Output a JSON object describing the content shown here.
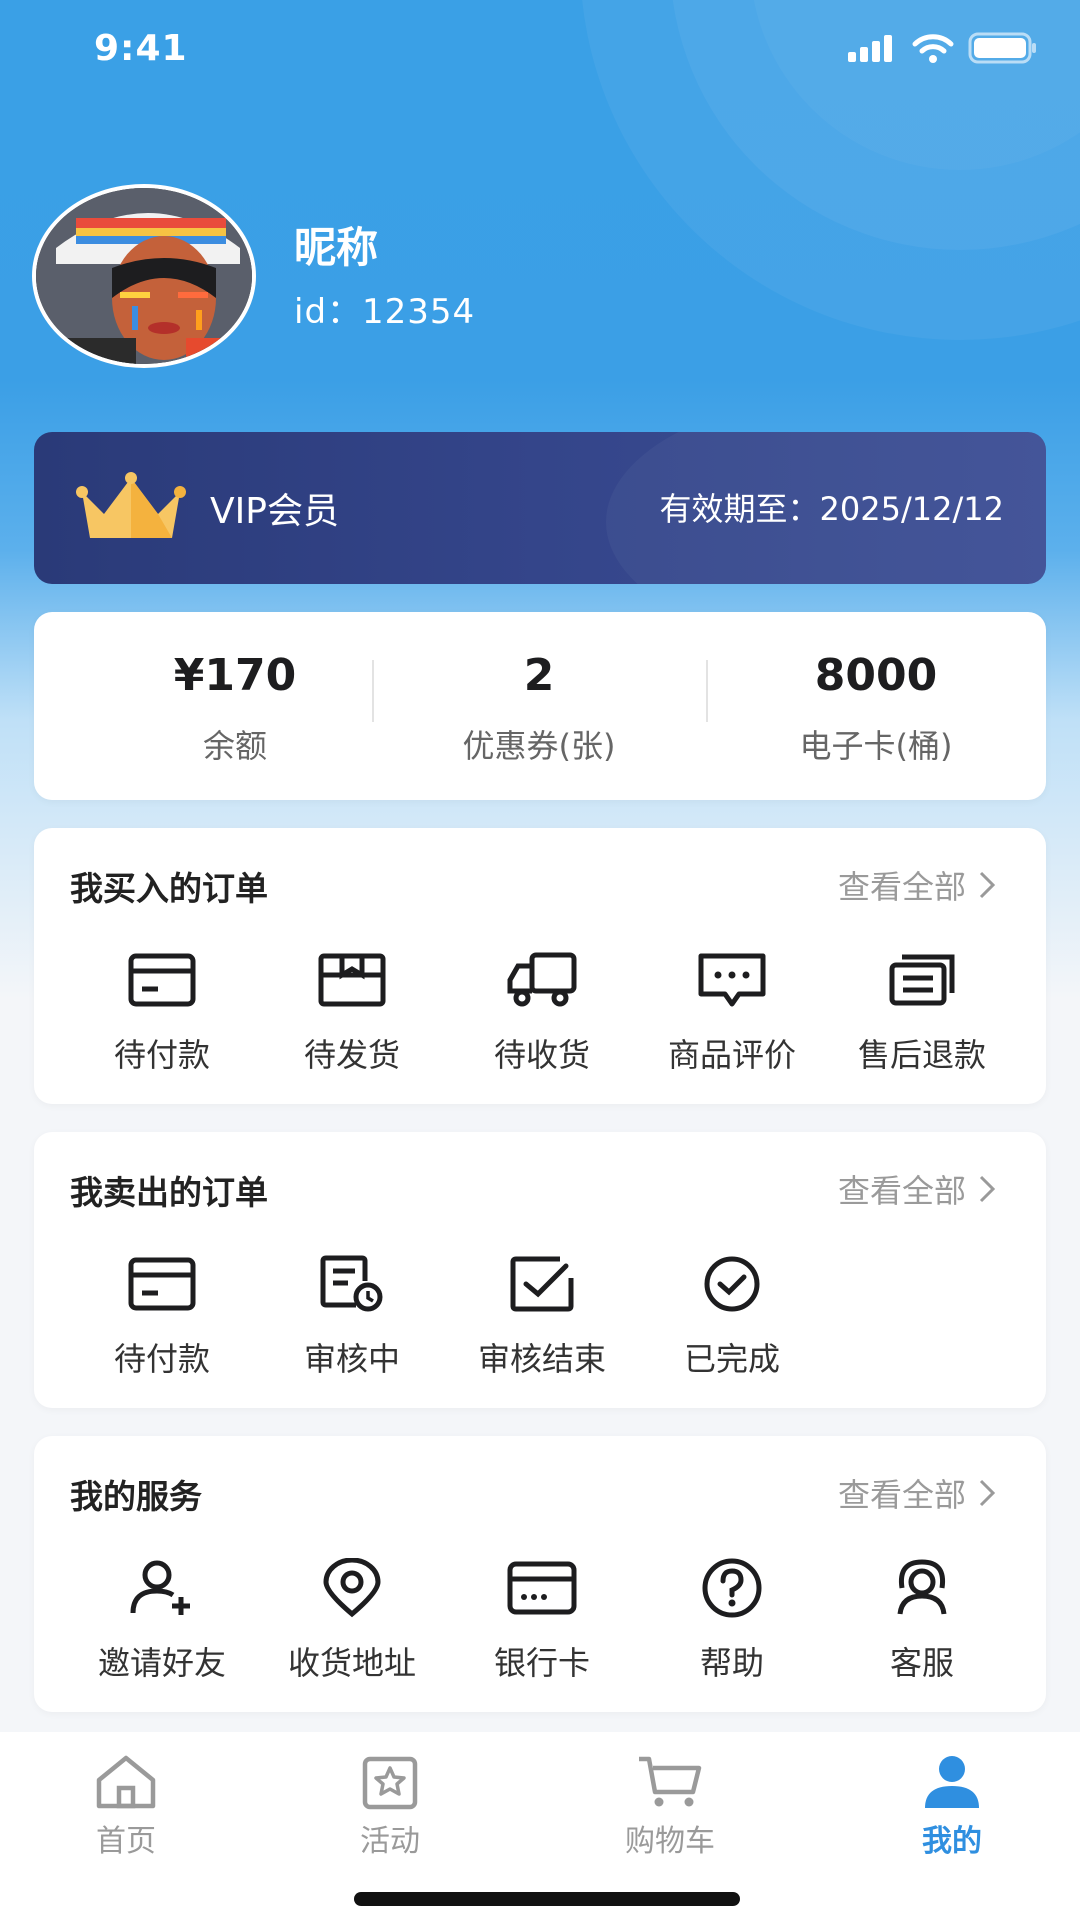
{
  "status_bar": {
    "time": "9:41",
    "icons": [
      "signal-icon",
      "wifi-icon",
      "battery-icon"
    ]
  },
  "profile": {
    "nickname": "昵称",
    "user_id": "id：12354",
    "avatar": "avatar-photo"
  },
  "vip": {
    "label": "VIP会员",
    "expiry": "有效期至：2025/12/12",
    "icon": "crown-icon"
  },
  "stats": [
    {
      "value": "¥170",
      "label": "余额"
    },
    {
      "value": "2",
      "label": "优惠券(张)"
    },
    {
      "value": "8000",
      "label": "电子卡(桶)"
    }
  ],
  "orders_buy": {
    "title": "我买入的订单",
    "view_all": "查看全部",
    "items": [
      {
        "label": "待付款",
        "icon": "card-icon"
      },
      {
        "label": "待发货",
        "icon": "box-icon"
      },
      {
        "label": "待收货",
        "icon": "truck-icon"
      },
      {
        "label": "商品评价",
        "icon": "comment-icon"
      },
      {
        "label": "售后退款",
        "icon": "refund-icon"
      }
    ]
  },
  "orders_sell": {
    "title": "我卖出的订单",
    "view_all": "查看全部",
    "items": [
      {
        "label": "待付款",
        "icon": "card-icon"
      },
      {
        "label": "审核中",
        "icon": "review-pending-icon"
      },
      {
        "label": "审核结束",
        "icon": "review-done-icon"
      },
      {
        "label": "已完成",
        "icon": "check-circle-icon"
      }
    ]
  },
  "services": {
    "title": "我的服务",
    "view_all": "查看全部",
    "items": [
      {
        "label": "邀请好友",
        "icon": "add-user-icon"
      },
      {
        "label": "收货地址",
        "icon": "location-icon"
      },
      {
        "label": "银行卡",
        "icon": "bank-card-icon"
      },
      {
        "label": "帮助",
        "icon": "help-icon"
      },
      {
        "label": "客服",
        "icon": "customer-service-icon"
      }
    ]
  },
  "tabbar": {
    "active": "我的",
    "tabs": [
      {
        "label": "首页",
        "icon": "home-icon"
      },
      {
        "label": "活动",
        "icon": "activity-icon"
      },
      {
        "label": "购物车",
        "icon": "cart-icon"
      },
      {
        "label": "我的",
        "icon": "user-icon"
      }
    ]
  },
  "colors": {
    "primary": "#3aa0e6",
    "vip_bg": "#2f3f82",
    "active_tab": "#2f8fe0",
    "crown": "#f7c663"
  }
}
